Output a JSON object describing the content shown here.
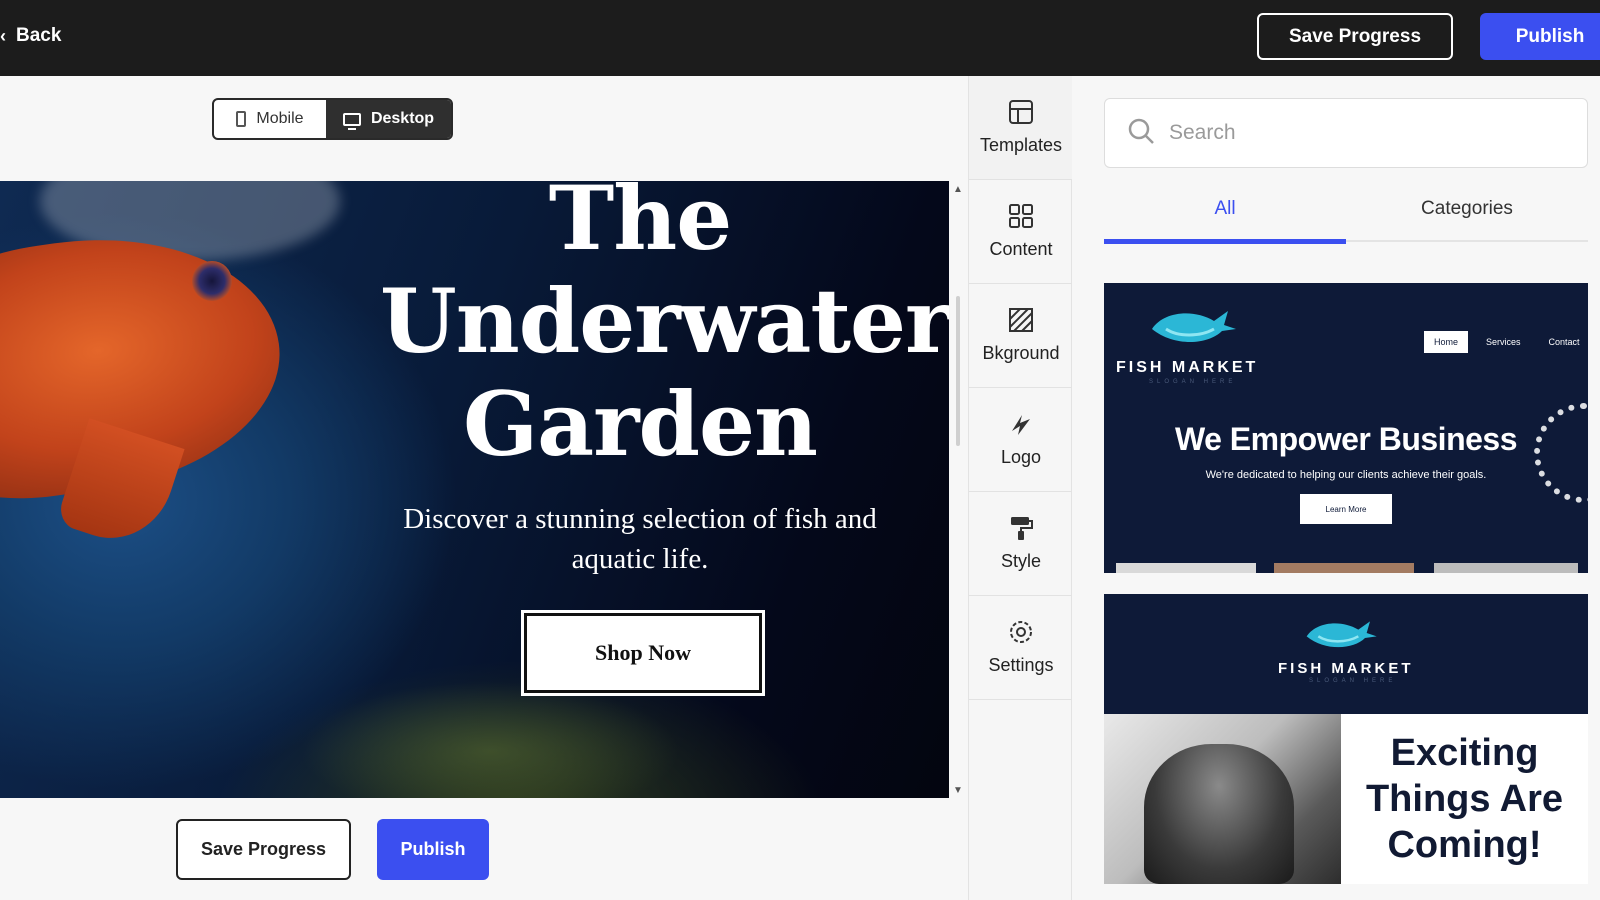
{
  "topbar": {
    "back_label": "Back",
    "save_label": "Save Progress",
    "publish_label": "Publish"
  },
  "canvas": {
    "device_toggle": {
      "mobile_label": "Mobile",
      "desktop_label": "Desktop",
      "selected": "Desktop"
    },
    "hero": {
      "title_line1": "The",
      "title_line2": "Underwater",
      "title_line3": "Garden",
      "subtitle": "Discover a stunning selection of fish and aquatic life.",
      "cta_label": "Shop Now"
    },
    "bottom_save_label": "Save Progress",
    "bottom_publish_label": "Publish"
  },
  "rail": {
    "items": [
      {
        "label": "Templates",
        "icon": "templates-icon",
        "active": true
      },
      {
        "label": "Content",
        "icon": "content-icon"
      },
      {
        "label": "Bkground",
        "icon": "background-icon"
      },
      {
        "label": "Logo",
        "icon": "logo-icon"
      },
      {
        "label": "Style",
        "icon": "style-icon"
      },
      {
        "label": "Settings",
        "icon": "settings-icon"
      }
    ]
  },
  "panel": {
    "search_placeholder": "Search",
    "tabs": [
      {
        "label": "All",
        "active": true
      },
      {
        "label": "Categories"
      }
    ],
    "templates": [
      {
        "brand": "FISH MARKET",
        "slogan": "SLOGAN HERE",
        "nav": [
          "Home",
          "Services",
          "Contact"
        ],
        "headline": "We Empower Business",
        "tagline": "We're dedicated to helping our clients achieve their goals.",
        "cta": "Learn More"
      },
      {
        "brand": "FISH MARKET",
        "slogan": "SLOGAN HERE",
        "headline": "Exciting Things Are Coming!"
      }
    ]
  },
  "colors": {
    "accent": "#3b4ff0",
    "topbar_bg": "#1c1c1c",
    "template_navy": "#0e1a38"
  }
}
